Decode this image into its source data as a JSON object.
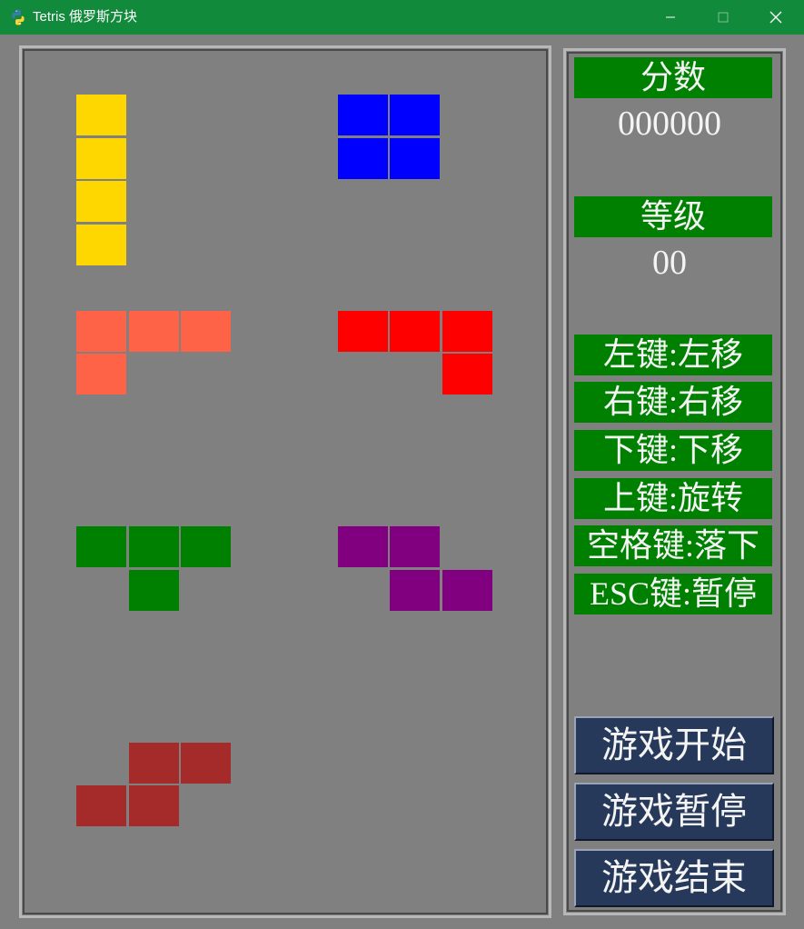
{
  "window": {
    "title": "Tetris 俄罗斯方块",
    "icon": "python-icon",
    "controls": [
      "minimize-icon",
      "maximize-icon",
      "close-icon"
    ]
  },
  "colors": {
    "titlebar": "#128a3c",
    "background": "#808080",
    "label_bg": "#008000",
    "button_bg": "#26395a",
    "text": "#f4f4f4"
  },
  "board": {
    "pieces": [
      {
        "name": "I",
        "color": "#ffd700",
        "cells": [
          [
            1,
            1
          ],
          [
            1,
            2
          ],
          [
            1,
            3
          ],
          [
            1,
            4
          ]
        ]
      },
      {
        "name": "O",
        "color": "#0000ff",
        "cells": [
          [
            6,
            1
          ],
          [
            7,
            1
          ],
          [
            6,
            2
          ],
          [
            7,
            2
          ]
        ]
      },
      {
        "name": "L",
        "color": "#ff6347",
        "cells": [
          [
            1,
            6
          ],
          [
            2,
            6
          ],
          [
            3,
            6
          ],
          [
            1,
            7
          ]
        ]
      },
      {
        "name": "J",
        "color": "#ff0000",
        "cells": [
          [
            6,
            6
          ],
          [
            7,
            6
          ],
          [
            8,
            6
          ],
          [
            8,
            7
          ]
        ]
      },
      {
        "name": "T",
        "color": "#008000",
        "cells": [
          [
            1,
            11
          ],
          [
            2,
            11
          ],
          [
            3,
            11
          ],
          [
            2,
            12
          ]
        ]
      },
      {
        "name": "Z",
        "color": "#800080",
        "cells": [
          [
            6,
            11
          ],
          [
            7,
            11
          ],
          [
            7,
            12
          ],
          [
            8,
            12
          ]
        ]
      },
      {
        "name": "S",
        "color": "#a52a2a",
        "cells": [
          [
            2,
            16
          ],
          [
            3,
            16
          ],
          [
            1,
            17
          ],
          [
            2,
            17
          ]
        ]
      }
    ]
  },
  "panel": {
    "score_label": "分数",
    "score_value": "000000",
    "level_label": "等级",
    "level_value": "00",
    "help": [
      "左键:左移",
      "右键:右移",
      "下键:下移",
      "上键:旋转",
      "空格键:落下",
      "ESC键:暂停"
    ],
    "buttons": {
      "start": "游戏开始",
      "pause": "游戏暂停",
      "end": "游戏结束"
    }
  }
}
